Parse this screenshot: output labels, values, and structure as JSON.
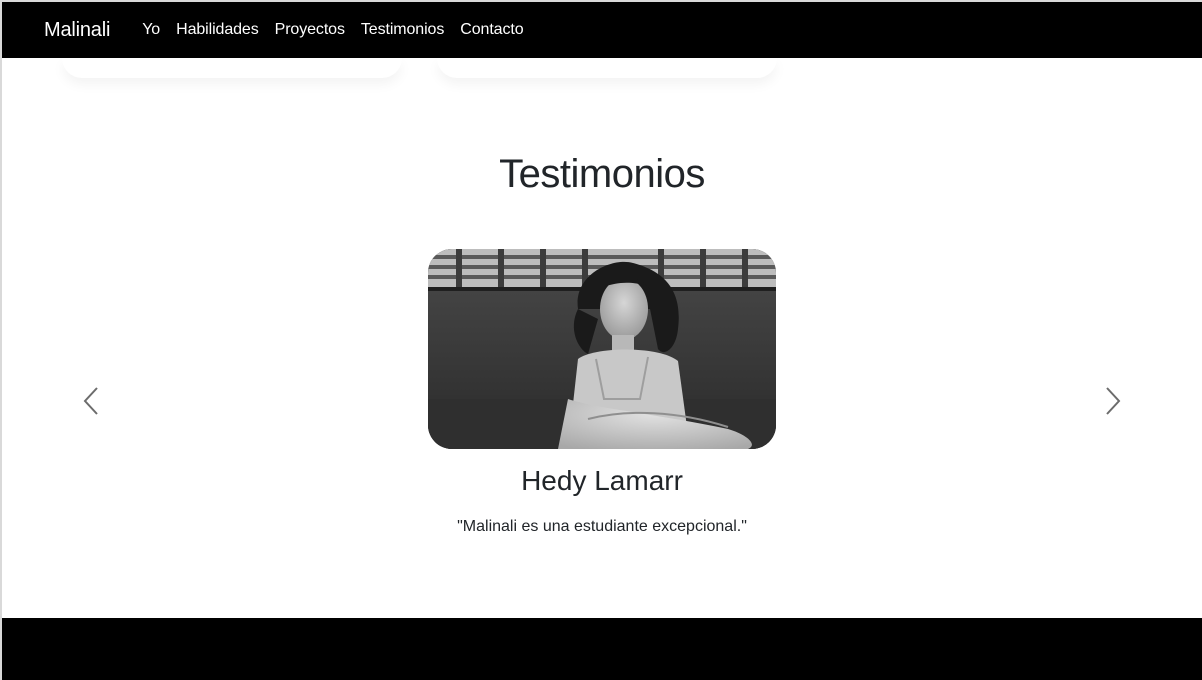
{
  "navbar": {
    "brand": "Malinali",
    "links": [
      "Yo",
      "Habilidades",
      "Proyectos",
      "Testimonios",
      "Contacto"
    ]
  },
  "testimonials": {
    "title": "Testimonios",
    "current": {
      "name": "Hedy Lamarr",
      "quote": "\"Malinali es una estudiante excepcional.\""
    }
  },
  "icons": {
    "prev": "chevron-left-icon",
    "next": "chevron-right-icon"
  },
  "colors": {
    "navbar_bg": "#000000",
    "footer_bg": "#000000",
    "text": "#212529"
  }
}
